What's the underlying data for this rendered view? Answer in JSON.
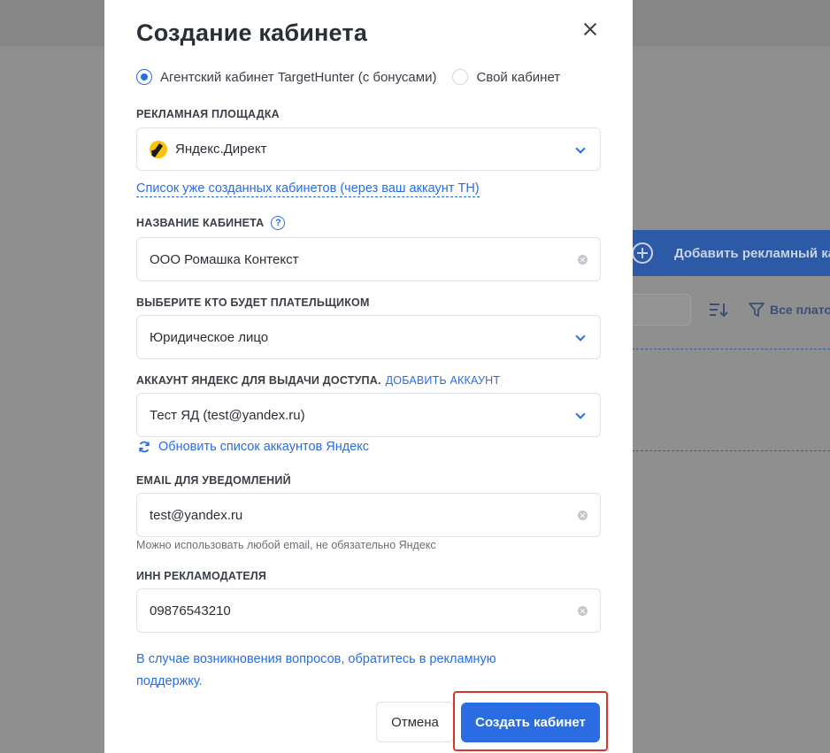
{
  "background": {
    "add_button_label": "Добавить рекламный каб",
    "filter_label": "Все плато"
  },
  "modal": {
    "title": "Создание кабинета",
    "radio_options": [
      {
        "label": "Агентский кабинет TargetHunter (с бонусами)",
        "checked": true
      },
      {
        "label": "Свой кабинет",
        "checked": false
      }
    ],
    "platform": {
      "label": "РЕКЛАМНАЯ ПЛОЩАДКА",
      "value": "Яндекс.Директ",
      "icon": "yandex-direct-logo"
    },
    "cabinets_list_link": "Список уже созданных кабинетов (через ваш аккаунт TH)",
    "cabinet_name": {
      "label": "НАЗВАНИЕ КАБИНЕТА",
      "help_icon": "?",
      "value": "ООО Ромашка Контекст"
    },
    "payer": {
      "label": "ВЫБЕРИТЕ КТО БУДЕТ ПЛАТЕЛЬЩИКОМ",
      "value": "Юридическое лицо"
    },
    "yandex_account": {
      "label": "АККАУНТ ЯНДЕКС ДЛЯ ВЫДАЧИ ДОСТУПА.",
      "add_link": "ДОБАВИТЬ АККАУНТ",
      "value": "Тест ЯД (test@yandex.ru)"
    },
    "refresh_link": "Обновить список аккаунтов Яндекс",
    "email": {
      "label": "EMAIL ДЛЯ УВЕДОМЛЕНИЙ",
      "value": "test@yandex.ru",
      "hint": "Можно использовать любой email, не обязательно Яндекс"
    },
    "inn": {
      "label": "ИНН РЕКЛАМОДАТЕЛЯ",
      "value": "09876543210"
    },
    "support_text": "В случае возникновения вопросов, обратитесь в рекламную поддержку.",
    "cancel_label": "Отмена",
    "create_label": "Создать кабинет"
  },
  "colors": {
    "accent": "#2a6de3",
    "highlight": "#d9352e"
  }
}
